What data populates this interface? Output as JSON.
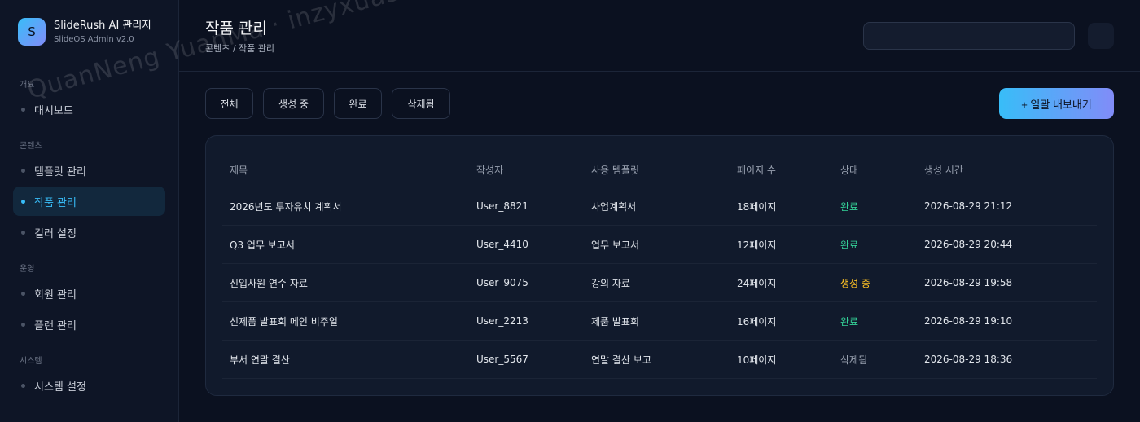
{
  "brand": {
    "logo_letter": "S",
    "title": "SlideRush AI 관리자",
    "subtitle": "SlideOS Admin v2.0"
  },
  "sidebar": {
    "sections": [
      {
        "label": "개요",
        "items": [
          {
            "label": "대시보드",
            "active": false
          }
        ]
      },
      {
        "label": "콘텐츠",
        "items": [
          {
            "label": "템플릿 관리",
            "active": false
          },
          {
            "label": "작품 관리",
            "active": true
          },
          {
            "label": "컬러 설정",
            "active": false
          }
        ]
      },
      {
        "label": "운영",
        "items": [
          {
            "label": "회원 관리",
            "active": false
          },
          {
            "label": "플랜 관리",
            "active": false
          }
        ]
      },
      {
        "label": "시스템",
        "items": [
          {
            "label": "시스템 설정",
            "active": false
          }
        ]
      }
    ]
  },
  "header": {
    "title": "작품 관리",
    "breadcrumb": "콘텐츠 / 작품 관리"
  },
  "filters": [
    "전체",
    "생성 중",
    "완료",
    "삭제됨"
  ],
  "export_button": "+ 일괄 내보내기",
  "table": {
    "columns": [
      "제목",
      "작성자",
      "사용 템플릿",
      "페이지 수",
      "상태",
      "생성 시간"
    ],
    "rows": [
      {
        "title": "2026년도 투자유치 계획서",
        "author": "User_8821",
        "template": "사업계획서",
        "pages": "18페이지",
        "status": "완료",
        "status_type": "done",
        "created": "2026-08-29 21:12"
      },
      {
        "title": "Q3 업무 보고서",
        "author": "User_4410",
        "template": "업무 보고서",
        "pages": "12페이지",
        "status": "완료",
        "status_type": "done",
        "created": "2026-08-29 20:44"
      },
      {
        "title": "신입사원 연수 자료",
        "author": "User_9075",
        "template": "강의 자료",
        "pages": "24페이지",
        "status": "생성 중",
        "status_type": "generating",
        "created": "2026-08-29 19:58"
      },
      {
        "title": "신제품 발표회 메인 비주얼",
        "author": "User_2213",
        "template": "제품 발표회",
        "pages": "16페이지",
        "status": "완료",
        "status_type": "done",
        "created": "2026-08-29 19:10"
      },
      {
        "title": "부서 연말 결산",
        "author": "User_5567",
        "template": "연말 결산 보고",
        "pages": "10페이지",
        "status": "삭제됨",
        "status_type": "deleted",
        "created": "2026-08-29 18:36"
      }
    ]
  },
  "colors": {
    "accent": "#38bdf8",
    "accent_end": "#818cf8",
    "status_done": "#34d399",
    "status_generating": "#fbbf24",
    "status_deleted": "#9aa2b1"
  },
  "watermark": "QuanNeng YuanMa · inzyxuashop.com"
}
